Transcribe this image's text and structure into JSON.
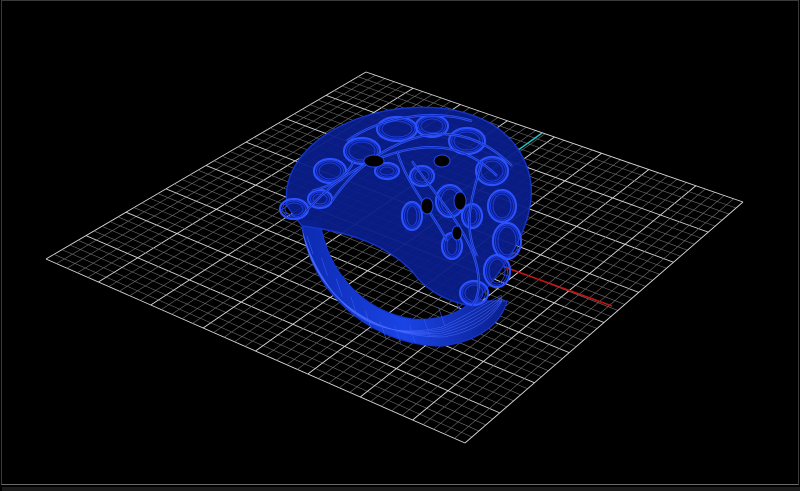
{
  "viewport": {
    "view_mode": "perspective",
    "display_mode": "wireframe",
    "grid": {
      "divisions": 40,
      "major_every": 5
    },
    "colors": {
      "background": "#000000",
      "grid_minor": "#6e6e6e",
      "grid_major": "#d8d8d8",
      "x_axis": "#c81414",
      "y_axis": "#1ec8c8",
      "model_wire": "#1436d2",
      "model_fill": "#0a1e8c"
    },
    "model": {
      "name_icon": "ring-mesh-icon"
    }
  }
}
